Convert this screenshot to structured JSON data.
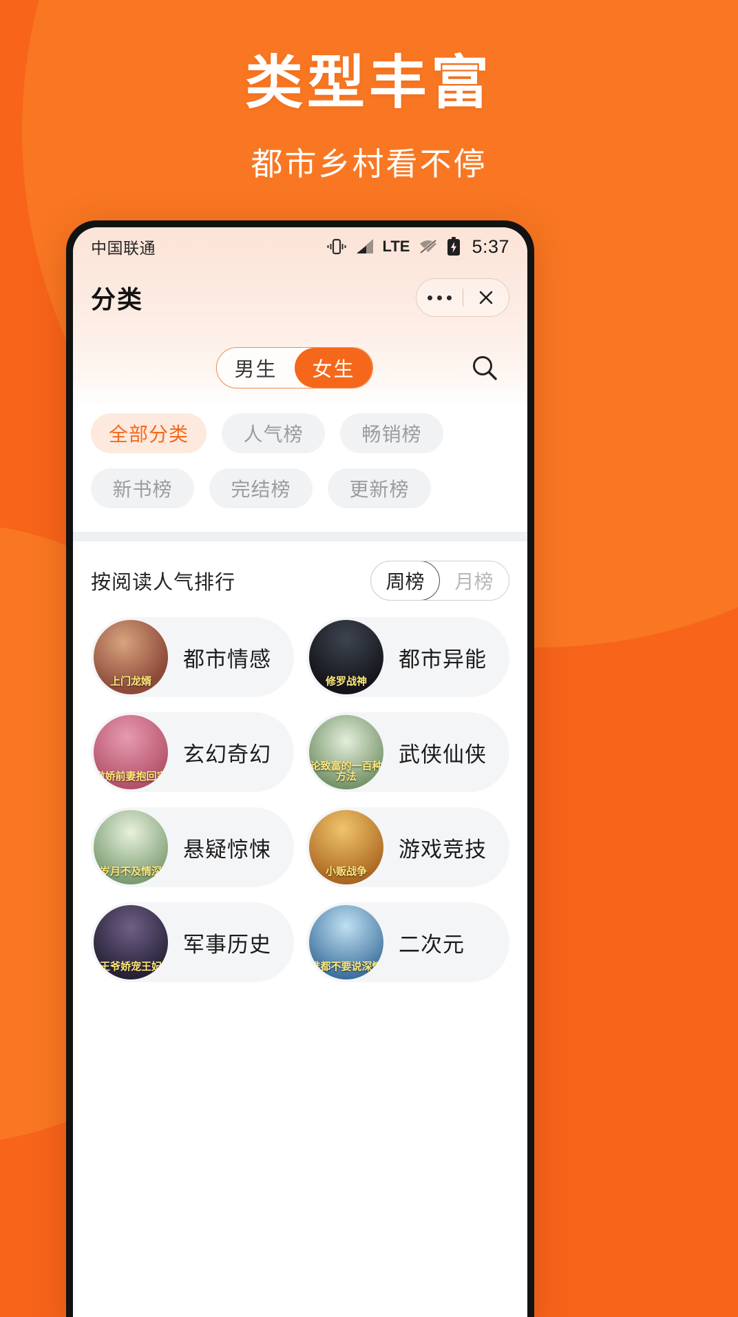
{
  "promo": {
    "title": "类型丰富",
    "subtitle": "都市乡村看不停"
  },
  "colors": {
    "brand_orange": "#F7641A",
    "accent_orange": "#F5681C",
    "chip_bg": "#F1F2F4",
    "chip_active_bg": "#FDE9DD",
    "statusbar_bg": "#FBE4D8"
  },
  "statusbar": {
    "carrier": "中国联通",
    "network": "LTE",
    "time": "5:37",
    "icons": [
      "vibrate-icon",
      "signal-icon",
      "lte-label",
      "wifi-off-icon",
      "battery-charging-icon"
    ]
  },
  "appbar": {
    "title": "分类",
    "more_icon": "more-dots-icon",
    "close_icon": "close-icon"
  },
  "gender_toggle": {
    "options": [
      {
        "label": "男生",
        "active": false
      },
      {
        "label": "女生",
        "active": true
      }
    ]
  },
  "search": {
    "icon": "search-icon"
  },
  "filter_chips": [
    {
      "label": "全部分类",
      "active": true
    },
    {
      "label": "人气榜",
      "active": false
    },
    {
      "label": "畅销榜",
      "active": false
    },
    {
      "label": "新书榜",
      "active": false
    },
    {
      "label": "完结榜",
      "active": false
    },
    {
      "label": "更新榜",
      "active": false
    }
  ],
  "rank_section": {
    "title": "按阅读人气排行",
    "period_options": [
      {
        "label": "周榜",
        "active": true
      },
      {
        "label": "月榜",
        "active": false
      }
    ]
  },
  "categories": [
    {
      "label": "都市情感",
      "cover_text": "上门龙婿",
      "c1": "#8d4a3a",
      "c2": "#d8a37e"
    },
    {
      "label": "都市异能",
      "cover_text": "修罗战神",
      "c1": "#1b1b22",
      "c2": "#3d4450"
    },
    {
      "label": "玄幻奇幻",
      "cover_text": "傲娇前妻抱回家",
      "c1": "#b3516a",
      "c2": "#e79bb0"
    },
    {
      "label": "武侠仙侠",
      "cover_text": "论致富的一百种方法",
      "c1": "#6f8f63",
      "c2": "#cfe0c0"
    },
    {
      "label": "悬疑惊悚",
      "cover_text": "岁月不及情深",
      "c1": "#789a6e",
      "c2": "#d6e4c6"
    },
    {
      "label": "游戏竞技",
      "cover_text": "小贩战争",
      "c1": "#a8631e",
      "c2": "#e6b35c"
    },
    {
      "label": "军事历史",
      "cover_text": "王爷娇宠王妃",
      "c1": "#2b2640",
      "c2": "#6e5f86"
    },
    {
      "label": "二次元",
      "cover_text": "谁都不要说深情",
      "c1": "#3c6f9c",
      "c2": "#9ec8e3"
    }
  ]
}
